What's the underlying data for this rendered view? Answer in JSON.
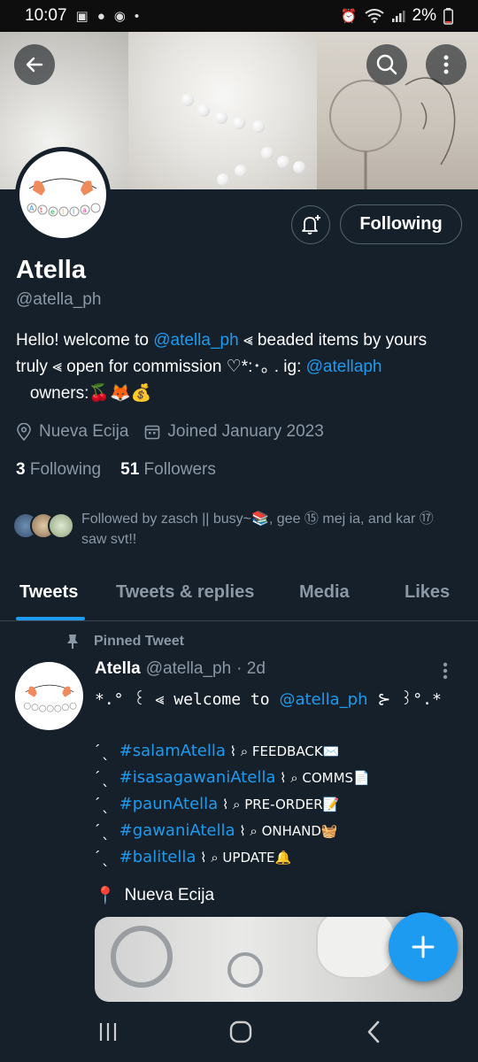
{
  "status_bar": {
    "time": "10:07",
    "battery": "2%"
  },
  "profile": {
    "name": "Atella",
    "handle": "@atella_ph",
    "bio": {
      "part1": "Hello! welcome to ",
      "link1": "@atella_ph",
      "part2": " ⪡ beaded items by yours truly ⪡ open for commission ♡*:･｡ . ig: ",
      "link2": "@atellaph",
      "part3": "   owners:🍒🦊💰"
    },
    "location": "Nueva Ecija",
    "joined": "Joined January 2023",
    "following_count": "3",
    "following_label": "Following",
    "followers_count": "51",
    "followers_label": "Followers",
    "followed_by": "Followed by zasch || busy~📚, gee ⑮ mej ia, and kar ⑰ saw svt!!",
    "follow_button": "Following",
    "avatar_text": "Atella"
  },
  "tabs": [
    "Tweets",
    "Tweets & replies",
    "Media",
    "Likes"
  ],
  "tweet": {
    "pinned_label": "Pinned Tweet",
    "author": "Atella",
    "handle": "@atella_ph",
    "time": "· 2d",
    "line1_a": "*.° ꒰ ⪡ welcome to ",
    "line1_link": "@atella_ph",
    "line1_b": " ⊱ ꒱°.*",
    "rows": [
      {
        "prefix": "ˊˎ ",
        "tag": "#salamAtella",
        "label": " ⌇ ⌕ FEEDBACK✉️"
      },
      {
        "prefix": "ˊˎ ",
        "tag": "#isasagawaniAtella",
        "label": " ⌇ ⌕ COMMS📄"
      },
      {
        "prefix": "ˊˎ ",
        "tag": "#paunAtella",
        "label": " ⌇ ⌕ PRE-ORDER📝"
      },
      {
        "prefix": "ˊˎ ",
        "tag": "#gawaniAtella",
        "label": " ⌇ ⌕ ONHAND🧺"
      },
      {
        "prefix": "ˊˎ ",
        "tag": "#balitella",
        "label": " ⌇ ⌕ UPDATE🔔"
      }
    ],
    "location": "Nueva Ecija",
    "location_pin": "📍"
  },
  "colors": {
    "background": "#15202b",
    "accent": "#1d9bf0",
    "secondary_text": "#8b98a5"
  }
}
